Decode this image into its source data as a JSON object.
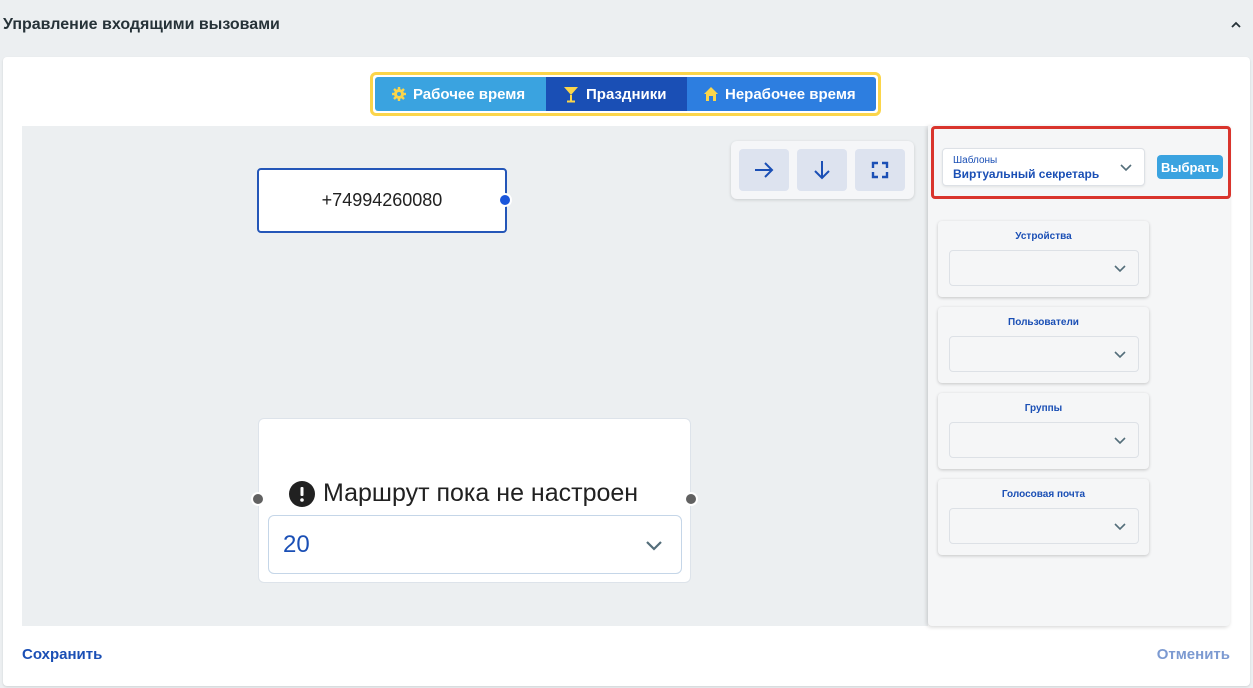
{
  "header": {
    "title": "Управление входящими вызовами"
  },
  "tabs": [
    {
      "label": "Рабочее время",
      "icon": "gear-icon"
    },
    {
      "label": "Праздники",
      "icon": "cocktail-icon"
    },
    {
      "label": "Нерабочее время",
      "icon": "home-icon"
    }
  ],
  "canvas": {
    "phone_node": {
      "number": "+74994260080"
    },
    "route_node": {
      "title": "Маршрут пока не настроен",
      "select_value": "20"
    }
  },
  "toolbar": {
    "icons": [
      "arrow-right-icon",
      "arrow-down-icon",
      "fullscreen-icon"
    ]
  },
  "sidebar": {
    "template": {
      "label": "Шаблоны",
      "value": "Виртуальный секретарь",
      "button": "Выбрать"
    },
    "groups": [
      {
        "title": "Устройства"
      },
      {
        "title": "Пользователи"
      },
      {
        "title": "Группы"
      },
      {
        "title": "Голосовая почта"
      }
    ]
  },
  "footer": {
    "save": "Сохранить",
    "cancel": "Отменить"
  },
  "colors": {
    "primary": "#1a4fb5",
    "accent": "#3aa3e0",
    "highlight": "#fbd54a",
    "alert": "#d9342c"
  }
}
